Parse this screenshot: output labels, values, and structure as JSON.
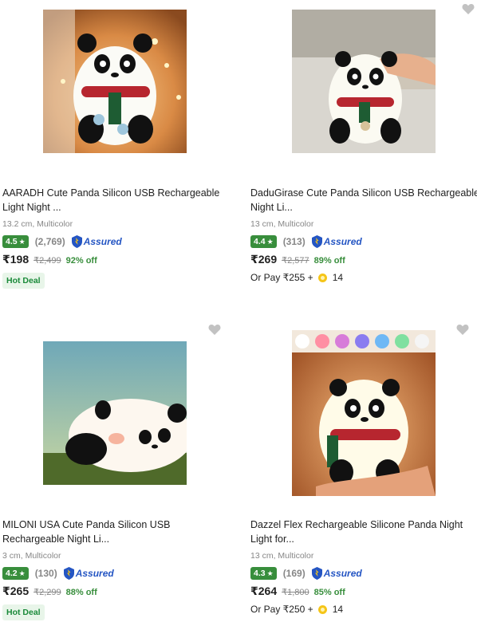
{
  "products": [
    {
      "title": "AARADH Cute Panda Silicon USB Rechargeable Light Night ...",
      "meta": "13.2 cm, Multicolor",
      "rating": "4.5",
      "reviews": "(2,769)",
      "assured": "Assured",
      "price": "₹198",
      "mrp": "₹2,499",
      "off": "92% off",
      "badge": "Hot Deal",
      "image_icon": "panda-lamp-red-scarf"
    },
    {
      "title": "DaduGirase Cute Panda Silicon USB Rechargeable Night Li...",
      "meta": "13 cm, Multicolor",
      "rating": "4.4",
      "reviews": "(313)",
      "assured": "Assured",
      "price": "₹269",
      "mrp": "₹2,577",
      "off": "89% off",
      "or_pay": "Or Pay ₹255 +",
      "coins": "14",
      "image_icon": "panda-lamp-touch"
    },
    {
      "title": "MILONI USA Cute Panda Silicon USB Rechargeable Night Li...",
      "meta": "3 cm, Multicolor",
      "rating": "4.2",
      "reviews": "(130)",
      "assured": "Assured",
      "price": "₹265",
      "mrp": "₹2,299",
      "off": "88% off",
      "badge": "Hot Deal",
      "image_icon": "lying-panda-lamp"
    },
    {
      "title": "Dazzel Flex Rechargeable Silicone Panda Night Light for...",
      "meta": "13 cm, Multicolor",
      "rating": "4.3",
      "reviews": "(169)",
      "assured": "Assured",
      "price": "₹264",
      "mrp": "₹1,800",
      "off": "85% off",
      "or_pay": "Or Pay ₹250 +",
      "coins": "14",
      "image_icon": "panda-lamp-in-hands"
    }
  ],
  "colors": {
    "rating_green": "#388e3c",
    "assured_blue": "#2455c3",
    "offer_green": "#388e3c",
    "hot_deal_bg": "#e8f5e9",
    "wishlist_grey": "#c2c2c2"
  }
}
